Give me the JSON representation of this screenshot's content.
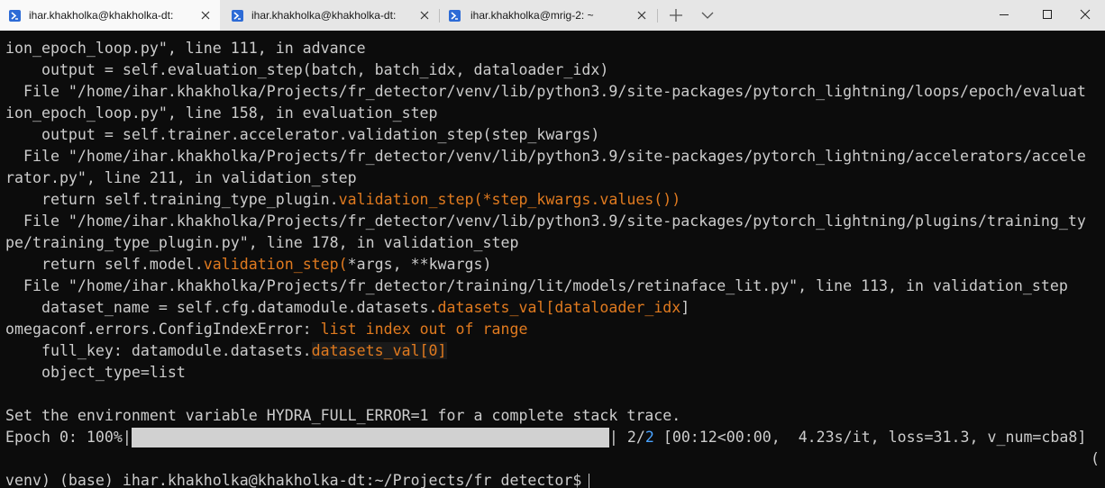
{
  "tabs": [
    {
      "title": "ihar.khakholka@khakholka-dt: ~",
      "active": true
    },
    {
      "title": "ihar.khakholka@khakholka-dt: ~",
      "active": false
    },
    {
      "title": "ihar.khakholka@mrig-2: ~",
      "active": false
    }
  ],
  "colors": {
    "background": "#0c0c0c",
    "text": "#cccccc",
    "highlight": "#e07a1f",
    "tabbar": "#e6e6e6",
    "progress_fill": "#d1d1d1"
  },
  "terminal": {
    "lines": [
      "ion_epoch_loop.py\", line 111, in advance",
      "    output = self.evaluation_step(batch, batch_idx, dataloader_idx)",
      "  File \"/home/ihar.khakholka/Projects/fr_detector/venv/lib/python3.9/site-packages/pytorch_lightning/loops/epoch/evaluat",
      "ion_epoch_loop.py\", line 158, in evaluation_step",
      "    output = self.trainer.accelerator.validation_step(step_kwargs)",
      "  File \"/home/ihar.khakholka/Projects/fr_detector/venv/lib/python3.9/site-packages/pytorch_lightning/accelerators/accele",
      "rator.py\", line 211, in validation_step"
    ],
    "line8": {
      "prefix": "    return self.training_type_plugin.",
      "hl": "validation_step(*step_kwargs.values())"
    },
    "line9": "  File \"/home/ihar.khakholka/Projects/fr_detector/venv/lib/python3.9/site-packages/pytorch_lightning/plugins/training_ty",
    "line10": "pe/training_type_plugin.py\", line 178, in validation_step",
    "line11": {
      "prefix": "    return self.model.",
      "hl": "validation_step(",
      "suffix": "*args, **kwargs)"
    },
    "line12": "  File \"/home/ihar.khakholka/Projects/fr_detector/training/lit/models/retinaface_lit.py\", line 113, in validation_step",
    "line13": {
      "prefix": "    dataset_name = self.cfg.datamodule.datasets.",
      "hl": "datasets_val[dataloader_idx",
      "suffix": "]"
    },
    "line14": {
      "prefix": "omegaconf.errors.ConfigIndexError: ",
      "hl": "list index out of range"
    },
    "line15": {
      "prefix": "    full_key: datamodule.datasets.",
      "hl": "datasets_val[0]"
    },
    "line16": "    object_type=list",
    "line17": "",
    "line18": "Set the environment variable HYDRA_FULL_ERROR=1 for a complete stack trace.",
    "progress": {
      "prefix": "Epoch 0: 100%|",
      "percent": 100,
      "sep": "| ",
      "done": "2/",
      "total": "2",
      "stats": " [00:12<00:00,  4.23s/it, loss=31.3, v_num=cba8]"
    },
    "paren_line": "(",
    "prompt": "venv) (base) ihar.khakholka@khakholka-dt:~/Projects/fr_detector$"
  }
}
